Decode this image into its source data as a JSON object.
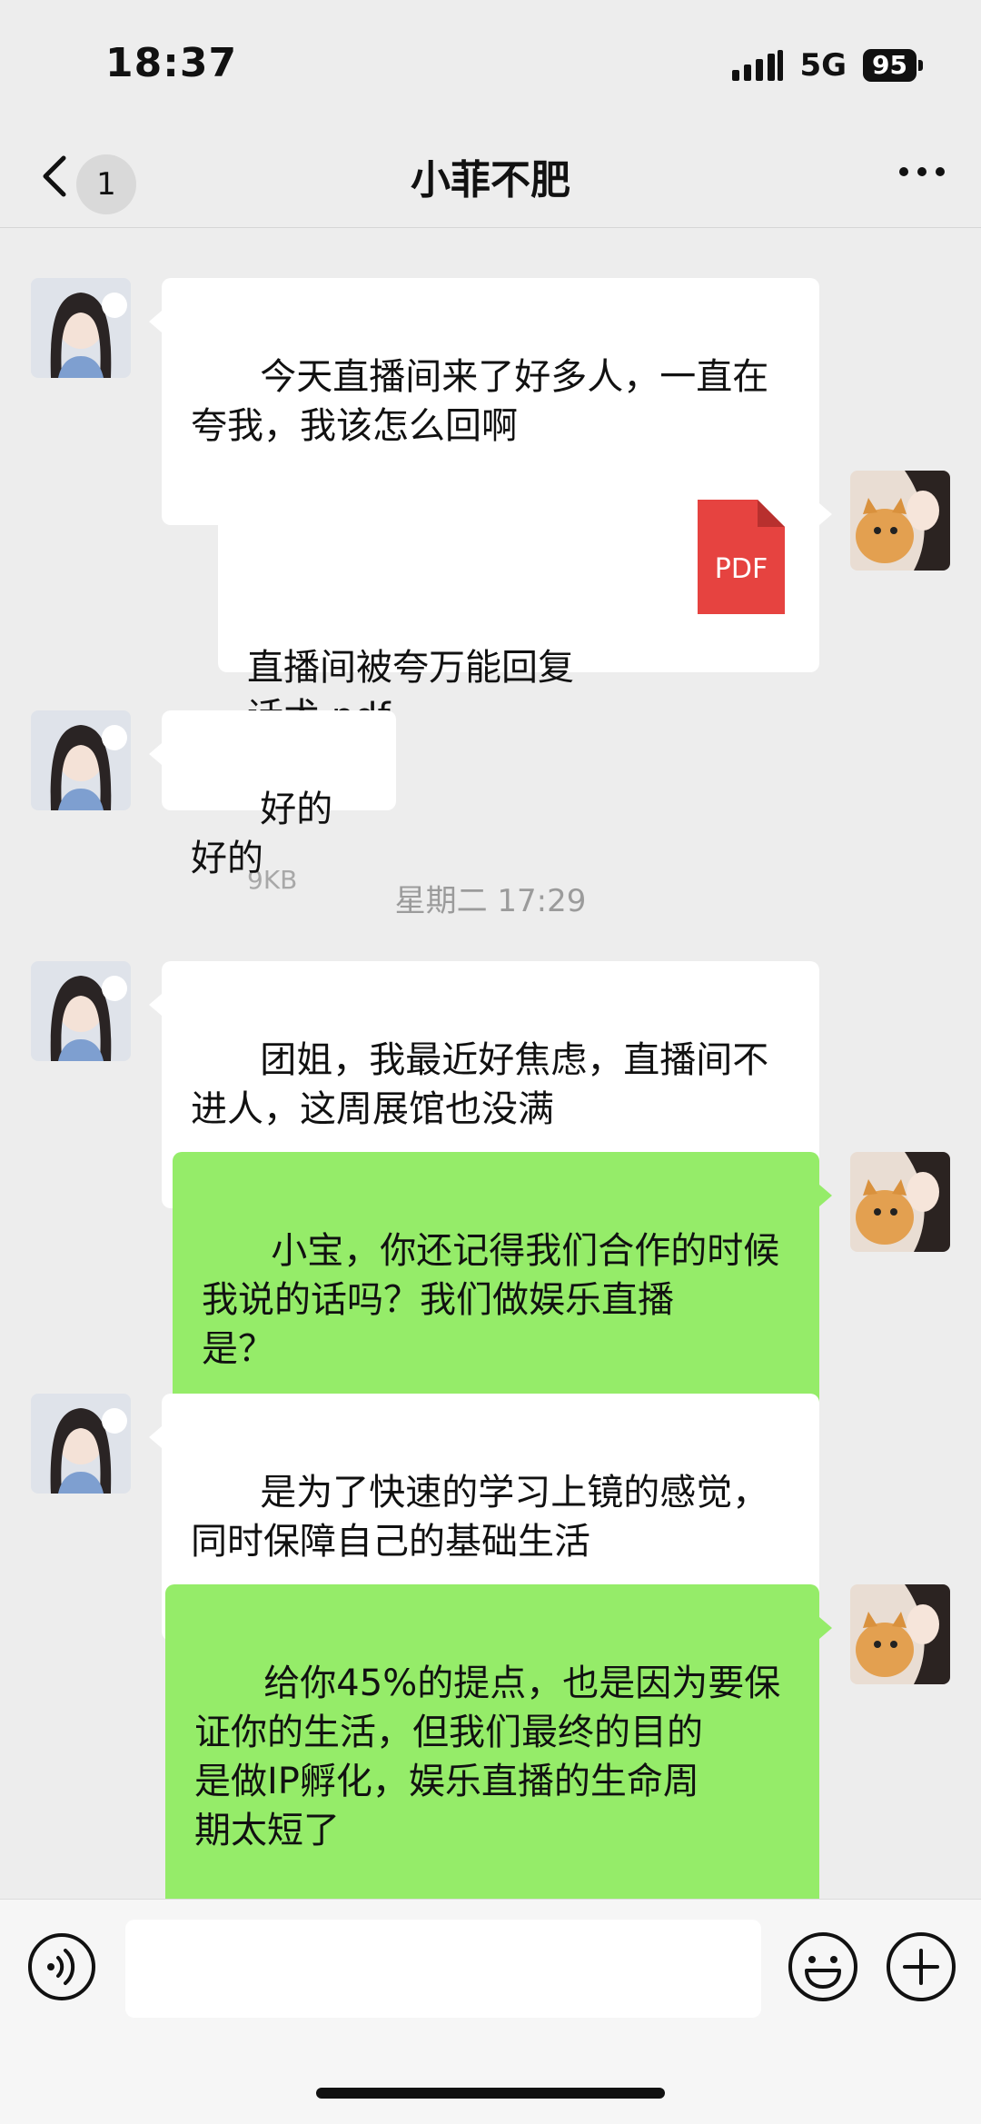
{
  "status_bar": {
    "time": "18:37",
    "network": "5G",
    "battery": "95"
  },
  "header": {
    "unread_count": "1",
    "title": "小菲不肥"
  },
  "messages": [
    {
      "text": "今天直播间来了好多人，一直在\n夸我，我该怎么回啊"
    },
    {
      "file_name": "直播间被夸万能回复\n话术.pdf",
      "file_size": "9KB",
      "file_type": "PDF"
    },
    {
      "text": "好的好的"
    },
    {
      "timestamp": "星期二 17:29"
    },
    {
      "text": "团姐，我最近好焦虑，直播间不\n进人，这周展馆也没满"
    },
    {
      "text": "小宝，你还记得我们合作的时候\n我说的话吗？我们做娱乐直播\n是？"
    },
    {
      "text": "是为了快速的学习上镜的感觉，\n同时保障自己的基础生活"
    },
    {
      "text": "给你45%的提点，也是因为要保\n证你的生活，但我们最终的目的\n是做IP孵化，娱乐直播的生命周\n期太短了"
    }
  ],
  "input": {
    "placeholder": ""
  },
  "colors": {
    "background": "#ededed",
    "sent_bubble": "#95ec69",
    "received_bubble": "#ffffff",
    "pdf_red": "#e64340"
  }
}
